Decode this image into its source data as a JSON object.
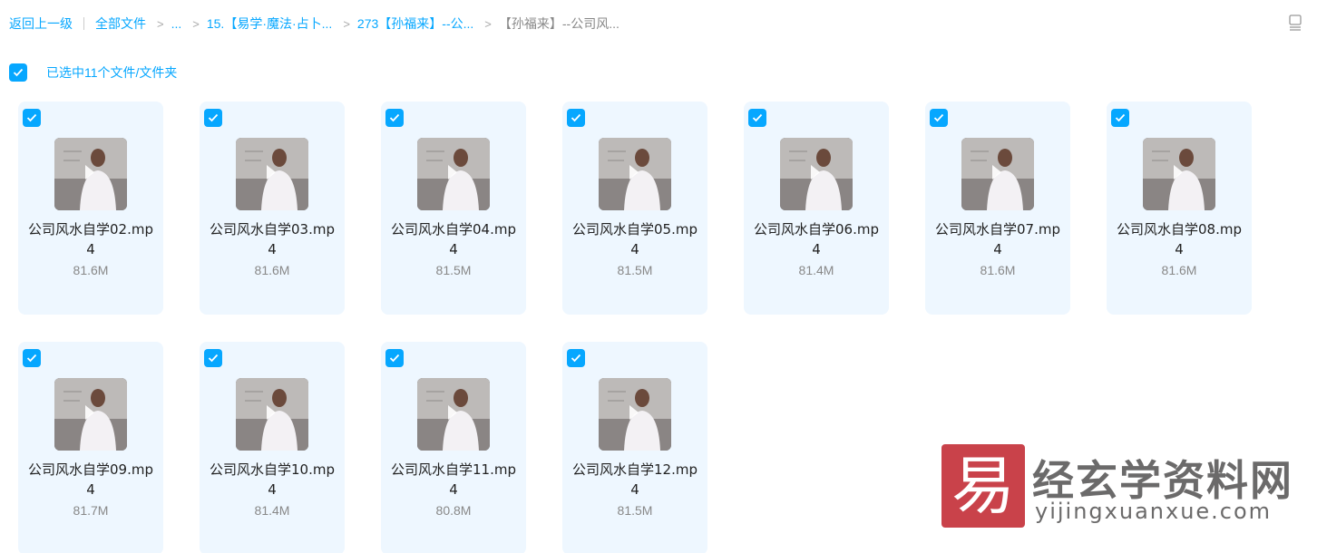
{
  "breadcrumb": {
    "back": "返回上一级",
    "all_files": "全部文件",
    "ellipsis": "...",
    "level1": "15.【易学·魔法·占卜...",
    "level2": "273【孙福来】--公...",
    "current": "【孙福来】--公司风...",
    "separator": ">"
  },
  "selection": {
    "label": "已选中11个文件/文件夹",
    "checked": true
  },
  "accent_color": "#06a7ff",
  "files": [
    {
      "name": "公司风水自学02.mp4",
      "size": "81.6M"
    },
    {
      "name": "公司风水自学03.mp4",
      "size": "81.6M"
    },
    {
      "name": "公司风水自学04.mp4",
      "size": "81.5M"
    },
    {
      "name": "公司风水自学05.mp4",
      "size": "81.5M"
    },
    {
      "name": "公司风水自学06.mp4",
      "size": "81.4M"
    },
    {
      "name": "公司风水自学07.mp4",
      "size": "81.6M"
    },
    {
      "name": "公司风水自学08.mp4",
      "size": "81.6M"
    },
    {
      "name": "公司风水自学09.mp4",
      "size": "81.7M"
    },
    {
      "name": "公司风水自学10.mp4",
      "size": "81.4M"
    },
    {
      "name": "公司风水自学11.mp4",
      "size": "80.8M"
    },
    {
      "name": "公司风水自学12.mp4",
      "size": "81.5M"
    }
  ],
  "watermark": {
    "logo_char": "易",
    "title": "经玄学资料网",
    "url": "yijingxuanxue.com"
  }
}
